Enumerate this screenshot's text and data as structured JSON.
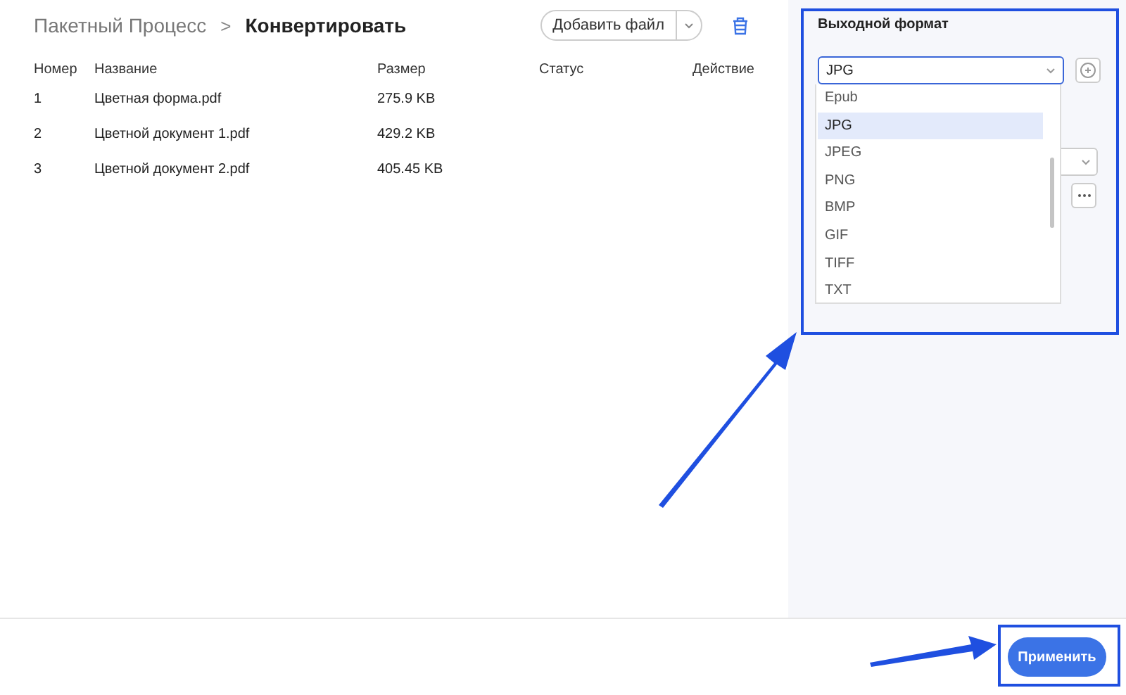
{
  "breadcrumb": {
    "parent": "Пакетный Процесс",
    "separator": ">",
    "current": "Конвертировать"
  },
  "toolbar": {
    "add_button": "Добавить файл"
  },
  "table": {
    "columns": [
      "Номер",
      "Название",
      "Размер",
      "Статус",
      "Действие"
    ],
    "rows": [
      {
        "number": "1",
        "name": "Цветная форма.pdf",
        "size": "275.9 KB"
      },
      {
        "number": "2",
        "name": "Цветной документ 1.pdf",
        "size": "429.2 KB"
      },
      {
        "number": "3",
        "name": "Цветной документ 2.pdf",
        "size": "405.45 KB"
      }
    ]
  },
  "panel": {
    "label": "Выходной формат",
    "format_value": "JPG",
    "options": [
      {
        "label": "Epub",
        "selected": false
      },
      {
        "label": "JPG",
        "selected": true
      },
      {
        "label": "JPEG",
        "selected": false
      },
      {
        "label": "PNG",
        "selected": false
      },
      {
        "label": "BMP",
        "selected": false
      },
      {
        "label": "GIF",
        "selected": false
      },
      {
        "label": "TIFF",
        "selected": false
      },
      {
        "label": "TXT",
        "selected": false
      }
    ]
  },
  "footer": {
    "apply_button": "Применить"
  }
}
